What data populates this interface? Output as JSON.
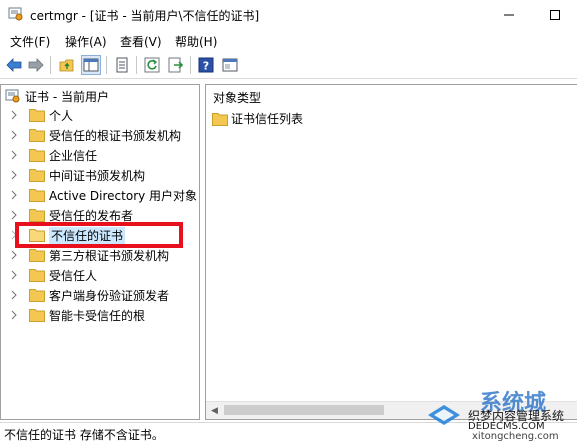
{
  "window": {
    "title": "certmgr - [证书 - 当前用户\\不信任的证书]"
  },
  "menu": {
    "items": [
      {
        "label": "文件(F)"
      },
      {
        "label": "操作(A)"
      },
      {
        "label": "查看(V)"
      },
      {
        "label": "帮助(H)"
      }
    ]
  },
  "toolbar": {
    "icons": [
      "back-arrow-icon",
      "forward-arrow-icon",
      "up-folder-icon",
      "show-hide-tree-icon",
      "properties-icon",
      "refresh-icon",
      "export-icon",
      "help-icon",
      "console-icon"
    ]
  },
  "tree": {
    "root": "证书 - 当前用户",
    "items": [
      {
        "label": "个人"
      },
      {
        "label": "受信任的根证书颁发机构"
      },
      {
        "label": "企业信任"
      },
      {
        "label": "中间证书颁发机构"
      },
      {
        "label": "Active Directory 用户对象"
      },
      {
        "label": "受信任的发布者"
      },
      {
        "label": "不信任的证书"
      },
      {
        "label": "第三方根证书颁发机构"
      },
      {
        "label": "受信任人"
      },
      {
        "label": "客户端身份验证颁发者"
      },
      {
        "label": "智能卡受信任的根"
      }
    ],
    "selected_index": 6
  },
  "list": {
    "column_header": "对象类型",
    "items": [
      {
        "label": "证书信任列表"
      }
    ]
  },
  "status": {
    "text": "不信任的证书 存储不含证书。"
  },
  "watermark": {
    "text1": "系统城",
    "text2": "织梦内容管理系统",
    "text3": "DEDECMS.COM",
    "text4": "xitongcheng.com"
  },
  "colors": {
    "highlight_red": "#e8101c",
    "selection_blue": "#cce8ff",
    "folder_yellow": "#f4c850"
  }
}
